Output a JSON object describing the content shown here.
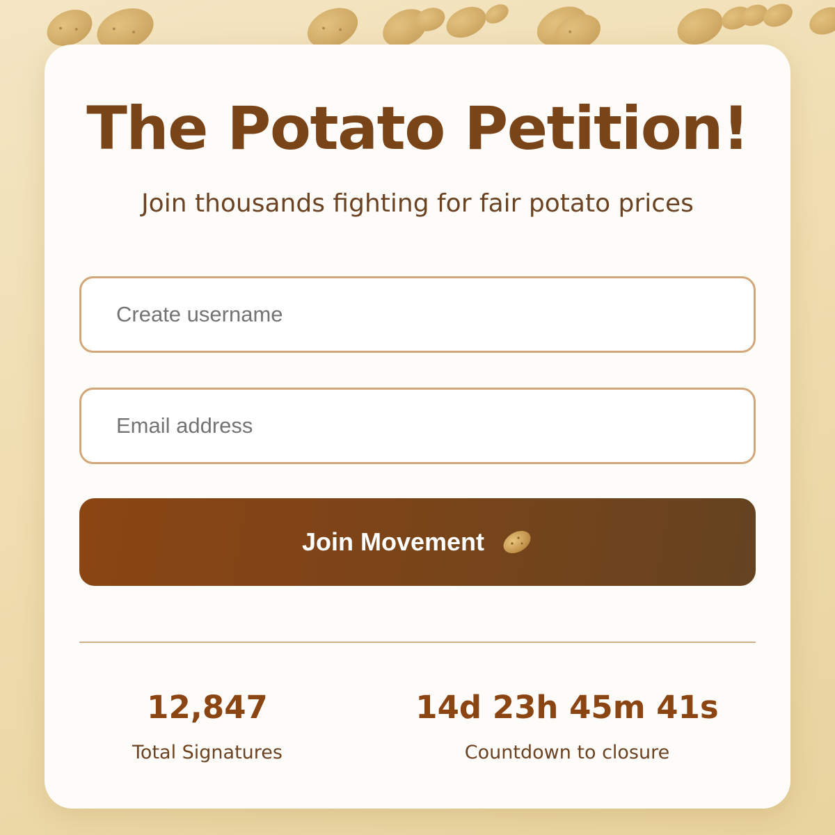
{
  "page": {
    "title": "The Potato Petition!",
    "subtitle": "Join thousands fighting for fair potato prices"
  },
  "form": {
    "username_placeholder": "Create username",
    "username_value": "",
    "email_placeholder": "Email address",
    "email_value": "",
    "submit_label": "Join Movement",
    "submit_icon": "potato-icon"
  },
  "stats": {
    "signatures": {
      "value": "12,847",
      "label": "Total Signatures"
    },
    "countdown": {
      "value": "14d 23h 45m 41s",
      "label": "Countdown to closure"
    }
  },
  "decoration": {
    "background_icon": "potato-icon"
  },
  "colors": {
    "brand_brown": "#8b4513",
    "dark_brown": "#654321",
    "input_border": "#d1a678",
    "background": "#efdcae",
    "card": "#fefcf9"
  }
}
